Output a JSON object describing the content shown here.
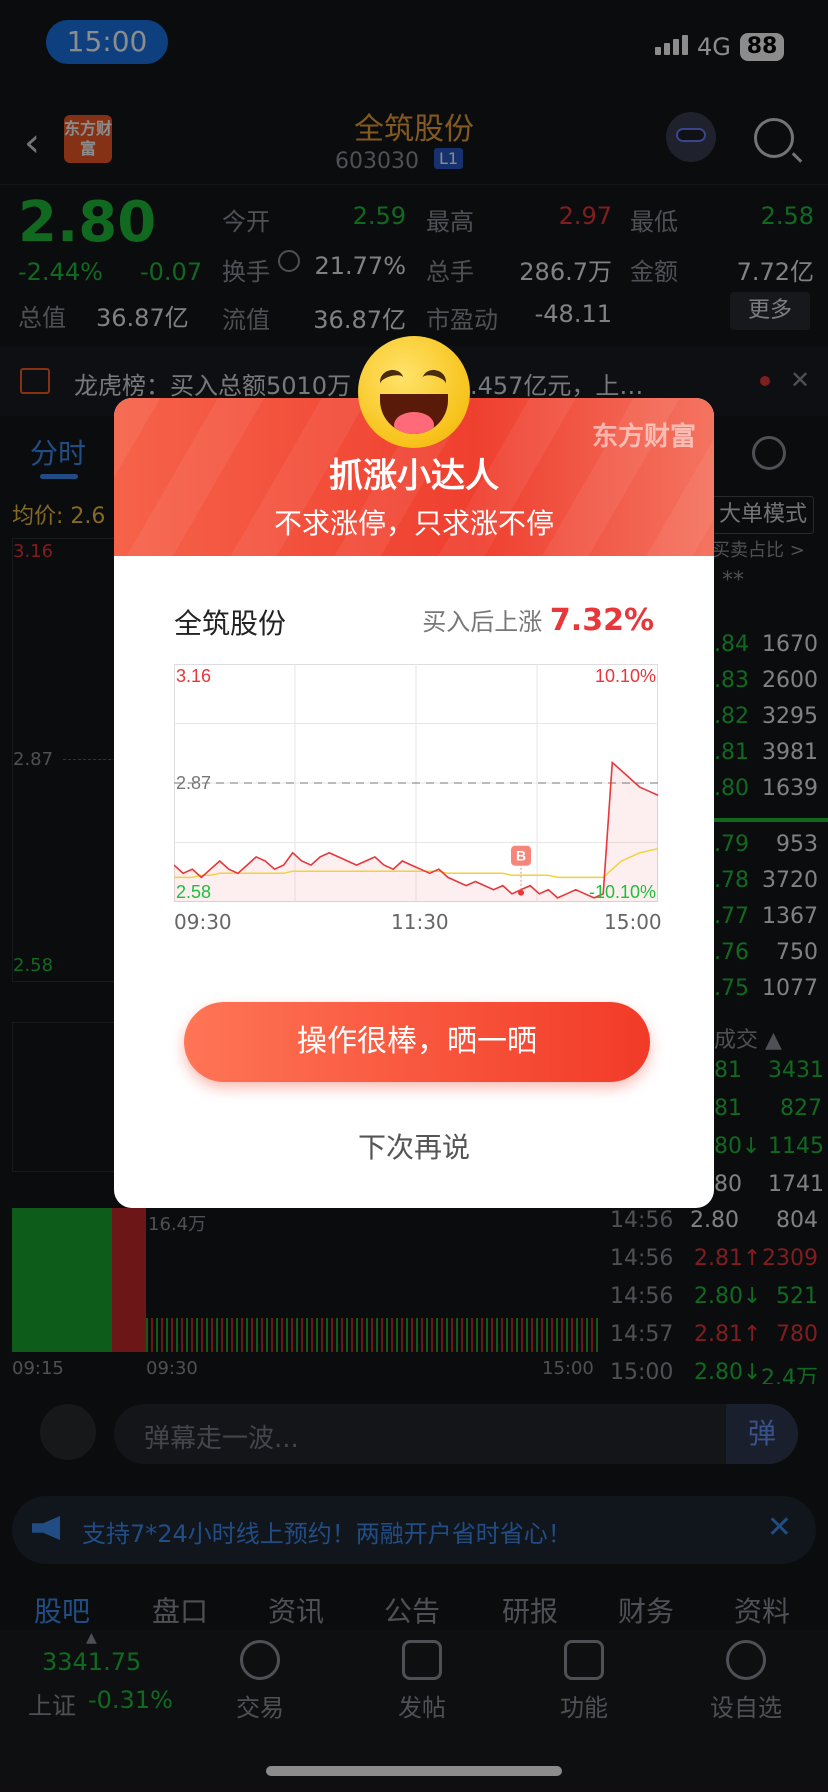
{
  "status_bar": {
    "time": "15:00",
    "network": "4G",
    "battery": "88"
  },
  "header": {
    "stock_name": "全筑股份",
    "stock_code": "603030",
    "level": "L1",
    "logo_text": "东方财富"
  },
  "quote": {
    "price": "2.80",
    "change_pct": "-2.44%",
    "change_abs": "-0.07",
    "rows": [
      [
        {
          "label": "今开",
          "value": "2.59",
          "color": "green"
        },
        {
          "label": "最高",
          "value": "2.97",
          "color": "red"
        },
        {
          "label": "最低",
          "value": "2.58",
          "color": "green"
        }
      ],
      [
        {
          "label": "换手",
          "value": "21.77%",
          "color": "white"
        },
        {
          "label": "总手",
          "value": "286.7万",
          "color": "white"
        },
        {
          "label": "金额",
          "value": "7.72亿",
          "color": "white"
        }
      ],
      [
        {
          "label": "流值",
          "value": "36.87亿",
          "color": "white"
        },
        {
          "label": "市盈动",
          "value": "-48.11",
          "color": "white"
        }
      ]
    ],
    "total_value_label": "总值",
    "total_value": "36.87亿",
    "more_label": "更多"
  },
  "news": {
    "text": "龙虎榜：买入总额5010万 卖出总额1.457亿元，上…"
  },
  "chart_tabs": {
    "active": "分时",
    "junjia_label": "均价: 2.6",
    "dadan_label": "大单模式"
  },
  "bg_chart_labels": {
    "top": "3.16",
    "mid": "2.87",
    "bottom": "2.58",
    "vol": "16.4万",
    "t0": "09:15",
    "t1": "09:30",
    "t2": "15:00"
  },
  "right_panel": {
    "head": "买卖占比 >",
    "stars": "**",
    "book": [
      {
        "p": ".84",
        "v": "1670"
      },
      {
        "p": ".83",
        "v": "2600"
      },
      {
        "p": ".82",
        "v": "3295"
      },
      {
        "p": ".81",
        "v": "3981"
      },
      {
        "p": ".80",
        "v": "1639"
      },
      {
        "p": ".79",
        "v": "953"
      },
      {
        "p": ".78",
        "v": "3720"
      },
      {
        "p": ".77",
        "v": "1367"
      },
      {
        "p": ".76",
        "v": "750"
      },
      {
        "p": ".75",
        "v": "1077"
      }
    ],
    "trades_head": "成交 ▲",
    "trades_partial": [
      {
        "p": "81",
        "v": "3431"
      },
      {
        "p": "81",
        "v": "827"
      },
      {
        "p": "80↓",
        "v": "1145"
      },
      {
        "p": "80",
        "v": "1741"
      }
    ],
    "trades": [
      {
        "t": "14:56",
        "p": "2.80",
        "v": "804",
        "c": "white"
      },
      {
        "t": "14:56",
        "p": "2.81↑",
        "v": "2309",
        "c": "red"
      },
      {
        "t": "14:56",
        "p": "2.80↓",
        "v": "521",
        "c": "green"
      },
      {
        "t": "14:57",
        "p": "2.81↑",
        "v": "780",
        "c": "red"
      },
      {
        "t": "15:00",
        "p": "2.80↓",
        "v": "2.4万",
        "c": "green"
      }
    ]
  },
  "danmu": {
    "placeholder": "弹幕走一波...",
    "button": "弹"
  },
  "promo": {
    "text": "支持7*24小时线上预约！两融开户省时省心！",
    "close": "✕"
  },
  "section_tabs": [
    "股吧",
    "盘口",
    "资讯",
    "公告",
    "研报",
    "财务",
    "资料"
  ],
  "bottom_nav": {
    "index_value": "3341.75",
    "index_name": "上证",
    "index_change": "-0.31%",
    "items": [
      "交易",
      "发帖",
      "功能",
      "设自选"
    ]
  },
  "modal": {
    "brand": "东方财富",
    "title": "抓涨小达人",
    "subtitle": "不求涨停，只求涨不停",
    "stock": "全筑股份",
    "after_label": "买入后上涨",
    "after_value": "7.32%",
    "button": "操作很棒，晒一晒",
    "later": "下次再说",
    "buy_marker": "B"
  },
  "chart_data": {
    "type": "line",
    "ylim": [
      2.58,
      3.16
    ],
    "y_ticks_left": [
      "3.16",
      "2.87",
      "2.58"
    ],
    "y_ticks_right": [
      "10.10%",
      "-10.10%"
    ],
    "x_ticks": [
      "09:30",
      "11:30",
      "15:00"
    ],
    "reference_price": 2.87,
    "series": [
      {
        "values": [
          2.67,
          2.65,
          2.66,
          2.64,
          2.66,
          2.68,
          2.66,
          2.65,
          2.67,
          2.69,
          2.68,
          2.66,
          2.67,
          2.7,
          2.68,
          2.67,
          2.69,
          2.7,
          2.69,
          2.68,
          2.67,
          2.68,
          2.69,
          2.67,
          2.66,
          2.68,
          2.67,
          2.66,
          2.65,
          2.66,
          2.64,
          2.63,
          2.62,
          2.63,
          2.62,
          2.61,
          2.62,
          2.6,
          2.61,
          2.62,
          2.6,
          2.61,
          2.59,
          2.6,
          2.61,
          2.6,
          2.59,
          2.6,
          2.92,
          2.9,
          2.88,
          2.86,
          2.85,
          2.84
        ]
      },
      {
        "values": [
          2.64,
          2.64,
          2.64,
          2.645,
          2.645,
          2.65,
          2.65,
          2.65,
          2.65,
          2.65,
          2.65,
          2.65,
          2.65,
          2.655,
          2.655,
          2.655,
          2.655,
          2.655,
          2.655,
          2.655,
          2.655,
          2.655,
          2.655,
          2.655,
          2.655,
          2.655,
          2.655,
          2.655,
          2.655,
          2.655,
          2.65,
          2.65,
          2.65,
          2.65,
          2.65,
          2.65,
          2.65,
          2.645,
          2.645,
          2.645,
          2.645,
          2.645,
          2.64,
          2.64,
          2.64,
          2.64,
          2.64,
          2.64,
          2.66,
          2.68,
          2.69,
          2.7,
          2.705,
          2.71
        ]
      }
    ],
    "buy_index": 38
  }
}
